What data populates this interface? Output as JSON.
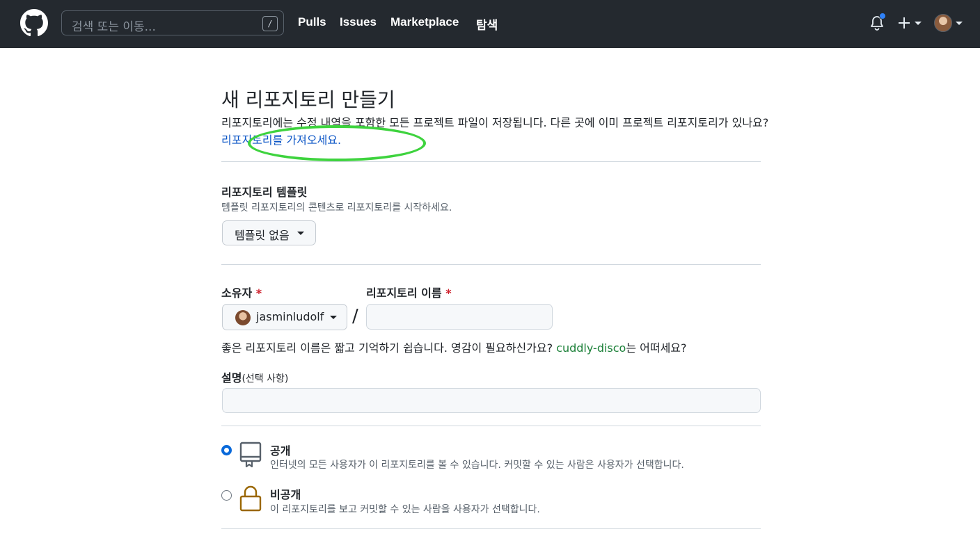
{
  "header": {
    "search_placeholder": "검색 또는 이동...",
    "search_shortcut": "/",
    "nav": [
      "Pulls",
      "Issues",
      "Marketplace",
      "탐색"
    ]
  },
  "page": {
    "title": "새 리포지토리 만들기",
    "intro_text": "리포지토리에는 수정 내역을 포함한 모든 프로젝트 파일이 저장됩니다. 다른 곳에 이미 프로젝트 리포지토리가 있나요? ",
    "import_link": "리포지토리를 가져오세요."
  },
  "template": {
    "title": "리포지토리 템플릿",
    "subtitle": "템플릿 리포지토리의 콘텐츠로 리포지토리를 시작하세요.",
    "button_label": "템플릿 없음"
  },
  "owner": {
    "label": "소유자",
    "required_mark": "*",
    "value": "jasminludolf"
  },
  "repo_name": {
    "label": "리포지토리 이름",
    "required_mark": "*",
    "separator": "/",
    "value": ""
  },
  "hint": {
    "before": "좋은 리포지토리 이름은 짧고 기억하기 쉽습니다. 영감이 필요하신가요? ",
    "suggestion": "cuddly-disco",
    "after": "는 어떠세요?"
  },
  "description": {
    "label": "설명",
    "optional": "(선택 사항)",
    "value": ""
  },
  "visibility": [
    {
      "title": "공개",
      "subtitle": "인터넷의 모든 사용자가 이 리포지토리를 볼 수 있습니다. 커밋할 수 있는 사람은 사용자가 선택합니다.",
      "checked": true
    },
    {
      "title": "비공개",
      "subtitle": "이 리포지토리를 보고 커밋할 수 있는 사람을 사용자가 선택합니다.",
      "checked": false
    }
  ],
  "colors": {
    "header_bg": "#24292f",
    "link": "#0b55c6",
    "suggestion": "#1a7f37",
    "required": "#cf222e",
    "highlight_ellipse": "#3ed33e"
  }
}
